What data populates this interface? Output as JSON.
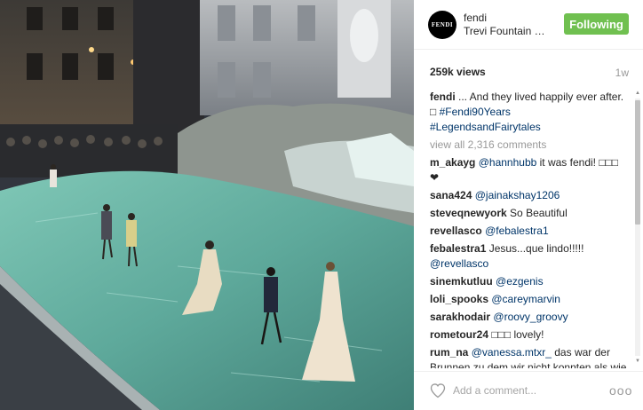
{
  "post": {
    "owner": "fendi",
    "location": "Trevi Fountain Ro...",
    "avatar_text": "FENDI",
    "follow_label": "Following",
    "views": "259k views",
    "age": "1w",
    "view_all": "view all 2,316 comments",
    "add_comment_placeholder": "Add a comment...",
    "more_label": "ooo"
  },
  "caption": {
    "user": "fendi",
    "text": " ... And they lived happily ever after. ",
    "glyph": "□",
    "tags": [
      "#Fendi90Years",
      "#LegendsandFairytales"
    ]
  },
  "comments": [
    {
      "user": "m_akayg",
      "mention": "@hannhubb",
      "text": " it was fendi! □□□",
      "extra": "❤"
    },
    {
      "user": "sana424",
      "mention": "@jainakshay1206",
      "text": ""
    },
    {
      "user": "steveqnewyork",
      "mention": "",
      "text": " So Beautiful"
    },
    {
      "user": "revellasco",
      "mention": "@febalestra1",
      "text": ""
    },
    {
      "user": "febalestra1",
      "mention": "",
      "text": " Jesus...que lindo!!!!!",
      "mention2": "@revellasco"
    },
    {
      "user": "sinemkutluu",
      "mention": "@ezgenis",
      "text": ""
    },
    {
      "user": "loli_spooks",
      "mention": "@careymarvin",
      "text": ""
    },
    {
      "user": "sarakhodair",
      "mention": "@roovy_groovy",
      "text": ""
    },
    {
      "user": "rometour24",
      "mention": "",
      "text": " □□□ lovely!"
    },
    {
      "user": "rum_na",
      "mention": "@vanessa.mtxr_",
      "text": " das war der Brunnen zu dem wir nicht konnten als wie in Rom waren"
    }
  ],
  "colors": {
    "follow_button": "#70c050",
    "mention": "#003569",
    "muted": "#999999"
  },
  "icons": {
    "heart": "heart-icon",
    "more": "more-options-icon"
  }
}
